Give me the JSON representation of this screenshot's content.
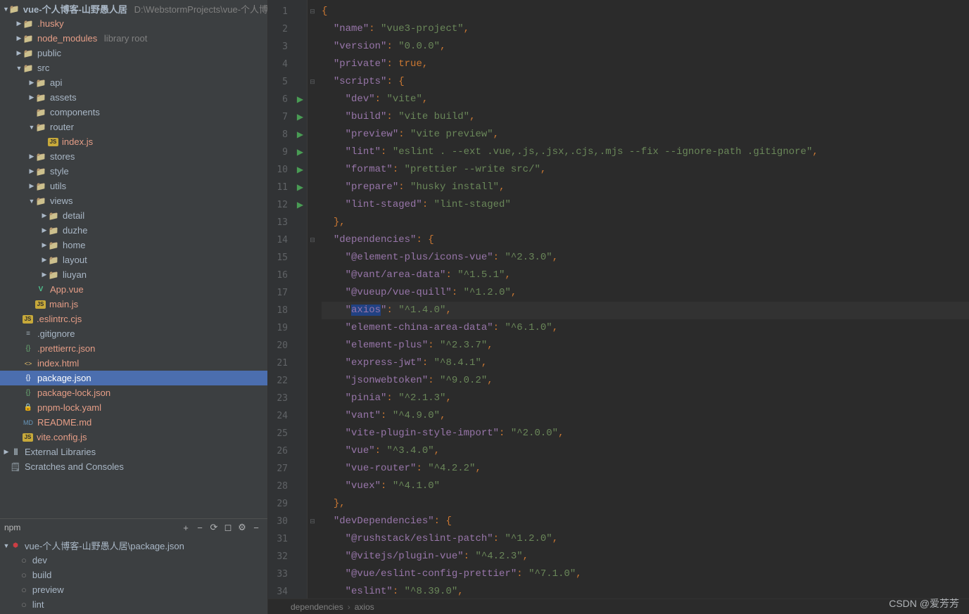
{
  "project": {
    "root_name": "vue-个人博客-山野愚人居",
    "root_path": "D:\\WebstormProjects\\vue-个人博客",
    "external_libs": "External Libraries",
    "scratches": "Scratches and Consoles",
    "library_root": "library root"
  },
  "tree": {
    "husky": ".husky",
    "node_modules": "node_modules",
    "public": "public",
    "src": "src",
    "api": "api",
    "assets": "assets",
    "components": "components",
    "router": "router",
    "index_js": "index.js",
    "stores": "stores",
    "style": "style",
    "utils": "utils",
    "views": "views",
    "detail": "detail",
    "duzhe": "duzhe",
    "home": "home",
    "layout": "layout",
    "liuyan": "liuyan",
    "app_vue": "App.vue",
    "main_js": "main.js",
    "eslintrc": ".eslintrc.cjs",
    "gitignore": ".gitignore",
    "prettierrc": ".prettierrc.json",
    "index_html": "index.html",
    "package_json": "package.json",
    "package_lock": "package-lock.json",
    "pnpm_lock": "pnpm-lock.yaml",
    "readme": "README.md",
    "vite_config": "vite.config.js"
  },
  "npm": {
    "title": "npm",
    "file": "vue-个人博客-山野愚人居\\package.json",
    "scripts": [
      "dev",
      "build",
      "preview",
      "lint"
    ]
  },
  "code_lines": [
    {
      "n": 1,
      "fold": "⊟",
      "tokens": [
        {
          "c": "punct",
          "t": "{"
        }
      ]
    },
    {
      "n": 2,
      "tokens": [
        {
          "t": "  "
        },
        {
          "c": "pkey",
          "t": "\"name\""
        },
        {
          "c": "punct",
          "t": ": "
        },
        {
          "c": "str",
          "t": "\"vue3-project\""
        },
        {
          "c": "punct",
          "t": ","
        }
      ]
    },
    {
      "n": 3,
      "tokens": [
        {
          "t": "  "
        },
        {
          "c": "pkey",
          "t": "\"version\""
        },
        {
          "c": "punct",
          "t": ": "
        },
        {
          "c": "str",
          "t": "\"0.0.0\""
        },
        {
          "c": "punct",
          "t": ","
        }
      ]
    },
    {
      "n": 4,
      "tokens": [
        {
          "t": "  "
        },
        {
          "c": "pkey",
          "t": "\"private\""
        },
        {
          "c": "punct",
          "t": ": "
        },
        {
          "c": "kw",
          "t": "true"
        },
        {
          "c": "punct",
          "t": ","
        }
      ]
    },
    {
      "n": 5,
      "fold": "⊟",
      "tokens": [
        {
          "t": "  "
        },
        {
          "c": "pkey",
          "t": "\"scripts\""
        },
        {
          "c": "punct",
          "t": ": {"
        }
      ]
    },
    {
      "n": 6,
      "run": true,
      "tokens": [
        {
          "t": "    "
        },
        {
          "c": "pkey",
          "t": "\"dev\""
        },
        {
          "c": "punct",
          "t": ": "
        },
        {
          "c": "str",
          "t": "\"vite\""
        },
        {
          "c": "punct",
          "t": ","
        }
      ]
    },
    {
      "n": 7,
      "run": true,
      "tokens": [
        {
          "t": "    "
        },
        {
          "c": "pkey",
          "t": "\"build\""
        },
        {
          "c": "punct",
          "t": ": "
        },
        {
          "c": "str",
          "t": "\"vite build\""
        },
        {
          "c": "punct",
          "t": ","
        }
      ]
    },
    {
      "n": 8,
      "run": true,
      "tokens": [
        {
          "t": "    "
        },
        {
          "c": "pkey",
          "t": "\"preview\""
        },
        {
          "c": "punct",
          "t": ": "
        },
        {
          "c": "str",
          "t": "\"vite preview\""
        },
        {
          "c": "punct",
          "t": ","
        }
      ]
    },
    {
      "n": 9,
      "run": true,
      "tokens": [
        {
          "t": "    "
        },
        {
          "c": "pkey",
          "t": "\"lint\""
        },
        {
          "c": "punct",
          "t": ": "
        },
        {
          "c": "str",
          "t": "\"eslint . --ext .vue,.js,.jsx,.cjs,.mjs --fix --ignore-path .gitignore\""
        },
        {
          "c": "punct",
          "t": ","
        }
      ]
    },
    {
      "n": 10,
      "run": true,
      "tokens": [
        {
          "t": "    "
        },
        {
          "c": "pkey",
          "t": "\"format\""
        },
        {
          "c": "punct",
          "t": ": "
        },
        {
          "c": "str",
          "t": "\"prettier --write src/\""
        },
        {
          "c": "punct",
          "t": ","
        }
      ]
    },
    {
      "n": 11,
      "run": true,
      "tokens": [
        {
          "t": "    "
        },
        {
          "c": "pkey",
          "t": "\"prepare\""
        },
        {
          "c": "punct",
          "t": ": "
        },
        {
          "c": "str",
          "t": "\"husky install\""
        },
        {
          "c": "punct",
          "t": ","
        }
      ]
    },
    {
      "n": 12,
      "run": true,
      "tokens": [
        {
          "t": "    "
        },
        {
          "c": "pkey",
          "t": "\"lint-staged\""
        },
        {
          "c": "punct",
          "t": ": "
        },
        {
          "c": "str",
          "t": "\"lint-staged\""
        }
      ]
    },
    {
      "n": 13,
      "tokens": [
        {
          "t": "  "
        },
        {
          "c": "punct",
          "t": "},"
        }
      ]
    },
    {
      "n": 14,
      "fold": "⊟",
      "tokens": [
        {
          "t": "  "
        },
        {
          "c": "pkey",
          "t": "\"dependencies\""
        },
        {
          "c": "punct",
          "t": ": {"
        }
      ]
    },
    {
      "n": 15,
      "tokens": [
        {
          "t": "    "
        },
        {
          "c": "pkey",
          "t": "\"@element-plus/icons-vue\""
        },
        {
          "c": "punct",
          "t": ": "
        },
        {
          "c": "str",
          "t": "\"^2.3.0\""
        },
        {
          "c": "punct",
          "t": ","
        }
      ]
    },
    {
      "n": 16,
      "tokens": [
        {
          "t": "    "
        },
        {
          "c": "pkey",
          "t": "\"@vant/area-data\""
        },
        {
          "c": "punct",
          "t": ": "
        },
        {
          "c": "str",
          "t": "\"^1.5.1\""
        },
        {
          "c": "punct",
          "t": ","
        }
      ]
    },
    {
      "n": 17,
      "tokens": [
        {
          "t": "    "
        },
        {
          "c": "pkey",
          "t": "\"@vueup/vue-quill\""
        },
        {
          "c": "punct",
          "t": ": "
        },
        {
          "c": "str",
          "t": "\"^1.2.0\""
        },
        {
          "c": "punct",
          "t": ","
        }
      ]
    },
    {
      "n": 18,
      "current": true,
      "tokens": [
        {
          "t": "    "
        },
        {
          "c": "pkey",
          "t": "\""
        },
        {
          "c": "pkey highlight",
          "t": "axios"
        },
        {
          "c": "pkey",
          "t": "\""
        },
        {
          "c": "punct",
          "t": ": "
        },
        {
          "c": "str",
          "t": "\"^1.4.0\""
        },
        {
          "c": "punct",
          "t": ","
        }
      ]
    },
    {
      "n": 19,
      "tokens": [
        {
          "t": "    "
        },
        {
          "c": "pkey",
          "t": "\"element-china-area-data\""
        },
        {
          "c": "punct",
          "t": ": "
        },
        {
          "c": "str",
          "t": "\"^6.1.0\""
        },
        {
          "c": "punct",
          "t": ","
        }
      ]
    },
    {
      "n": 20,
      "tokens": [
        {
          "t": "    "
        },
        {
          "c": "pkey",
          "t": "\"element-plus\""
        },
        {
          "c": "punct",
          "t": ": "
        },
        {
          "c": "str",
          "t": "\"^2.3.7\""
        },
        {
          "c": "punct",
          "t": ","
        }
      ]
    },
    {
      "n": 21,
      "tokens": [
        {
          "t": "    "
        },
        {
          "c": "pkey",
          "t": "\"express-jwt\""
        },
        {
          "c": "punct",
          "t": ": "
        },
        {
          "c": "str",
          "t": "\"^8.4.1\""
        },
        {
          "c": "punct",
          "t": ","
        }
      ]
    },
    {
      "n": 22,
      "tokens": [
        {
          "t": "    "
        },
        {
          "c": "pkey",
          "t": "\"jsonwebtoken\""
        },
        {
          "c": "punct",
          "t": ": "
        },
        {
          "c": "str",
          "t": "\"^9.0.2\""
        },
        {
          "c": "punct",
          "t": ","
        }
      ]
    },
    {
      "n": 23,
      "tokens": [
        {
          "t": "    "
        },
        {
          "c": "pkey",
          "t": "\"pinia\""
        },
        {
          "c": "punct",
          "t": ": "
        },
        {
          "c": "str",
          "t": "\"^2.1.3\""
        },
        {
          "c": "punct",
          "t": ","
        }
      ]
    },
    {
      "n": 24,
      "tokens": [
        {
          "t": "    "
        },
        {
          "c": "pkey",
          "t": "\"vant\""
        },
        {
          "c": "punct",
          "t": ": "
        },
        {
          "c": "str",
          "t": "\"^4.9.0\""
        },
        {
          "c": "punct",
          "t": ","
        }
      ]
    },
    {
      "n": 25,
      "tokens": [
        {
          "t": "    "
        },
        {
          "c": "pkey",
          "t": "\"vite-plugin-style-import\""
        },
        {
          "c": "punct",
          "t": ": "
        },
        {
          "c": "str",
          "t": "\"^2.0.0\""
        },
        {
          "c": "punct",
          "t": ","
        }
      ]
    },
    {
      "n": 26,
      "tokens": [
        {
          "t": "    "
        },
        {
          "c": "pkey",
          "t": "\"vue\""
        },
        {
          "c": "punct",
          "t": ": "
        },
        {
          "c": "str",
          "t": "\"^3.4.0\""
        },
        {
          "c": "punct",
          "t": ","
        }
      ]
    },
    {
      "n": 27,
      "tokens": [
        {
          "t": "    "
        },
        {
          "c": "pkey",
          "t": "\"vue-router\""
        },
        {
          "c": "punct",
          "t": ": "
        },
        {
          "c": "str",
          "t": "\"^4.2.2\""
        },
        {
          "c": "punct",
          "t": ","
        }
      ]
    },
    {
      "n": 28,
      "tokens": [
        {
          "t": "    "
        },
        {
          "c": "pkey",
          "t": "\"vuex\""
        },
        {
          "c": "punct",
          "t": ": "
        },
        {
          "c": "str",
          "t": "\"^4.1.0\""
        }
      ]
    },
    {
      "n": 29,
      "tokens": [
        {
          "t": "  "
        },
        {
          "c": "punct",
          "t": "},"
        }
      ]
    },
    {
      "n": 30,
      "fold": "⊟",
      "tokens": [
        {
          "t": "  "
        },
        {
          "c": "pkey",
          "t": "\"devDependencies\""
        },
        {
          "c": "punct",
          "t": ": {"
        }
      ]
    },
    {
      "n": 31,
      "tokens": [
        {
          "t": "    "
        },
        {
          "c": "pkey",
          "t": "\"@rushstack/eslint-patch\""
        },
        {
          "c": "punct",
          "t": ": "
        },
        {
          "c": "str",
          "t": "\"^1.2.0\""
        },
        {
          "c": "punct",
          "t": ","
        }
      ]
    },
    {
      "n": 32,
      "tokens": [
        {
          "t": "    "
        },
        {
          "c": "pkey",
          "t": "\"@vitejs/plugin-vue\""
        },
        {
          "c": "punct",
          "t": ": "
        },
        {
          "c": "str",
          "t": "\"^4.2.3\""
        },
        {
          "c": "punct",
          "t": ","
        }
      ]
    },
    {
      "n": 33,
      "tokens": [
        {
          "t": "    "
        },
        {
          "c": "pkey",
          "t": "\"@vue/eslint-config-prettier\""
        },
        {
          "c": "punct",
          "t": ": "
        },
        {
          "c": "str",
          "t": "\"^7.1.0\""
        },
        {
          "c": "punct",
          "t": ","
        }
      ]
    },
    {
      "n": 34,
      "tokens": [
        {
          "t": "    "
        },
        {
          "c": "pkey",
          "t": "\"eslint\""
        },
        {
          "c": "punct",
          "t": ": "
        },
        {
          "c": "str",
          "t": "\"^8.39.0\""
        },
        {
          "c": "punct",
          "t": ","
        }
      ]
    }
  ],
  "breadcrumb": [
    "dependencies",
    "axios"
  ],
  "watermark": "CSDN @爱芳芳"
}
